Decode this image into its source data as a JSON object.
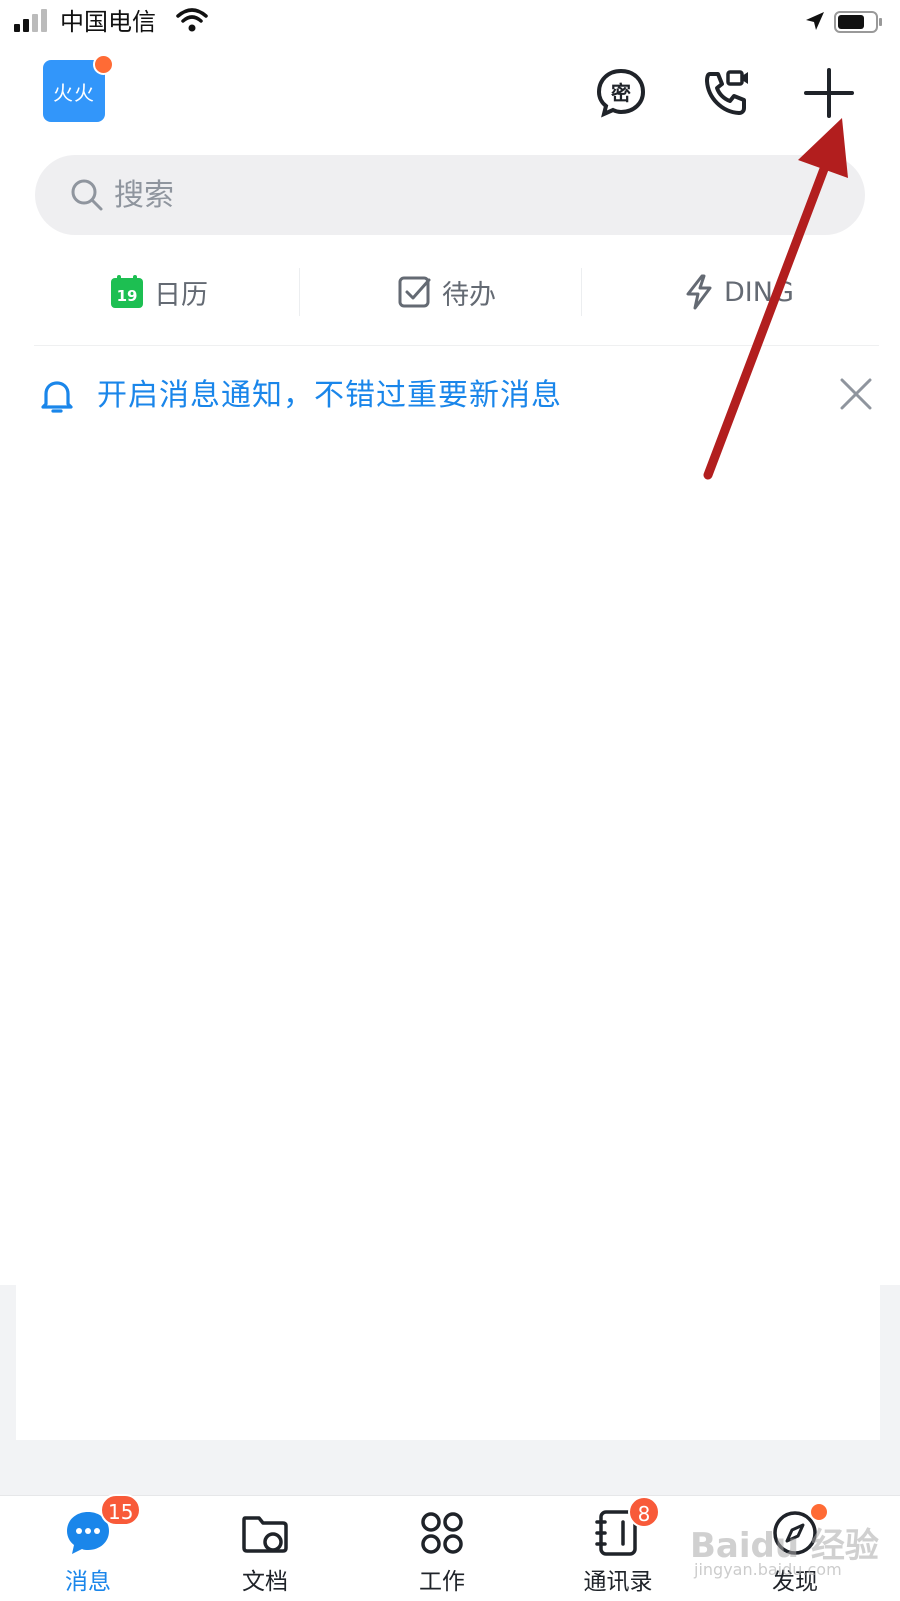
{
  "status_bar": {
    "carrier": "中国电信"
  },
  "header": {
    "avatar_text": "火火"
  },
  "search": {
    "placeholder": "搜索"
  },
  "quick_actions": [
    {
      "label": "日历",
      "icon": "calendar-icon",
      "day": "19"
    },
    {
      "label": "待办",
      "icon": "todo-check-icon"
    },
    {
      "label": "DING",
      "icon": "lightning-icon"
    }
  ],
  "notice": {
    "text": "开启消息通知，不错过重要新消息"
  },
  "tabs": [
    {
      "label": "消息",
      "icon": "chat-bubble-icon",
      "badge": "15",
      "active": true
    },
    {
      "label": "文档",
      "icon": "folder-icon"
    },
    {
      "label": "工作",
      "icon": "grid-apps-icon"
    },
    {
      "label": "通讯录",
      "icon": "contacts-book-icon",
      "badge": "8"
    },
    {
      "label": "发现",
      "icon": "compass-icon",
      "dot": true
    }
  ],
  "watermark": {
    "text": "Baidu 经验",
    "sub": "jingyan.baidu.com"
  },
  "colors": {
    "accent": "#1a86ea",
    "avatar": "#3296fa",
    "badge": "#f85a39",
    "annotation": "#b21e1e",
    "calendar": "#1dbf52"
  }
}
